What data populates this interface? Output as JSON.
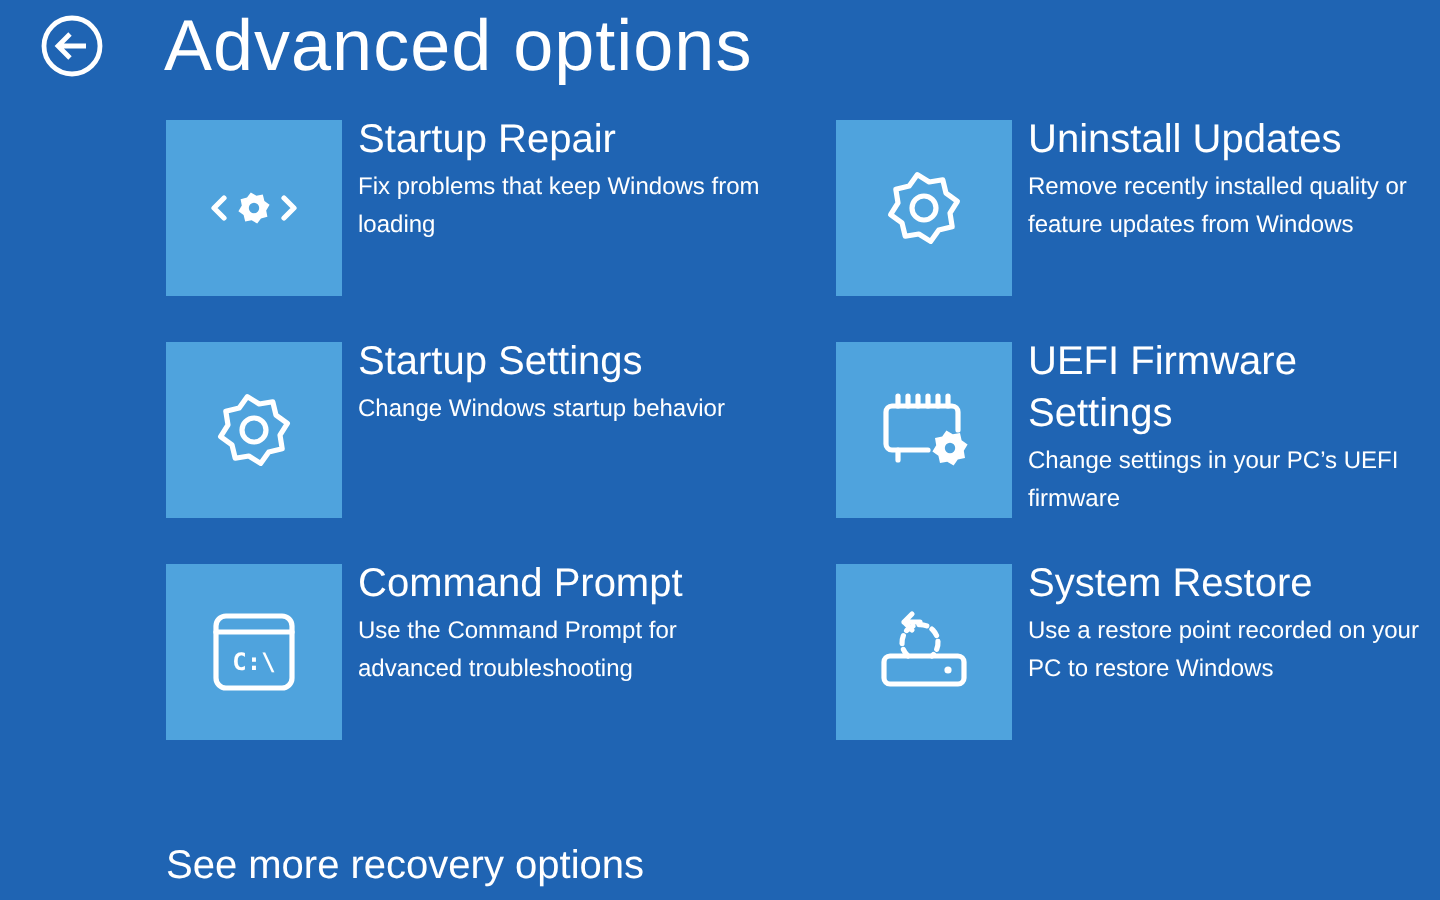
{
  "header": {
    "title": "Advanced options"
  },
  "options": [
    {
      "kind": "repair",
      "title": "Startup Repair",
      "description": "Fix problems that keep Windows from loading"
    },
    {
      "kind": "uninstall",
      "title": "Uninstall Updates",
      "description": "Remove recently installed quality or feature updates from Windows"
    },
    {
      "kind": "settings",
      "title": "Startup Settings",
      "description": "Change Windows startup behavior"
    },
    {
      "kind": "firmware",
      "title": "UEFI Firmware Settings",
      "description": "Change settings in your PC’s UEFI firmware"
    },
    {
      "kind": "prompt",
      "title": "Command Prompt",
      "description": "Use the Command Prompt for advanced troubleshooting",
      "icon_text": "C:\\"
    },
    {
      "kind": "restore",
      "title": "System Restore",
      "description": "Use a restore point recorded on your PC to restore Windows"
    }
  ],
  "more_link": "See more recovery options"
}
